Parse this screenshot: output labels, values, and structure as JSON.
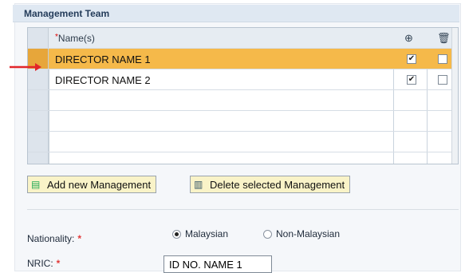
{
  "section": {
    "title": "Management Team"
  },
  "table": {
    "name_header": "Name(s)",
    "required_mark": "*",
    "rows": [
      {
        "name": "DIRECTOR NAME 1",
        "selected": true,
        "active_checked": true,
        "delete_checked": false
      },
      {
        "name": "DIRECTOR NAME 2",
        "selected": false,
        "active_checked": true,
        "delete_checked": false
      }
    ],
    "check_mark": "✔"
  },
  "toolbar": {
    "add_label": "Add new Management",
    "delete_label": "Delete selected Management"
  },
  "form": {
    "nationality_label": "Nationality:",
    "nationality_options": [
      "Malaysian",
      "Non-Malaysian"
    ],
    "nationality_selected": "Malaysian",
    "nric_label": "NRIC:",
    "nric_value": "ID NO. NAME 1",
    "required_star": "*"
  },
  "colors": {
    "selected_row": "#f5b94a",
    "arrow": "#e2262a",
    "button_bg": "#f9f3c8"
  }
}
